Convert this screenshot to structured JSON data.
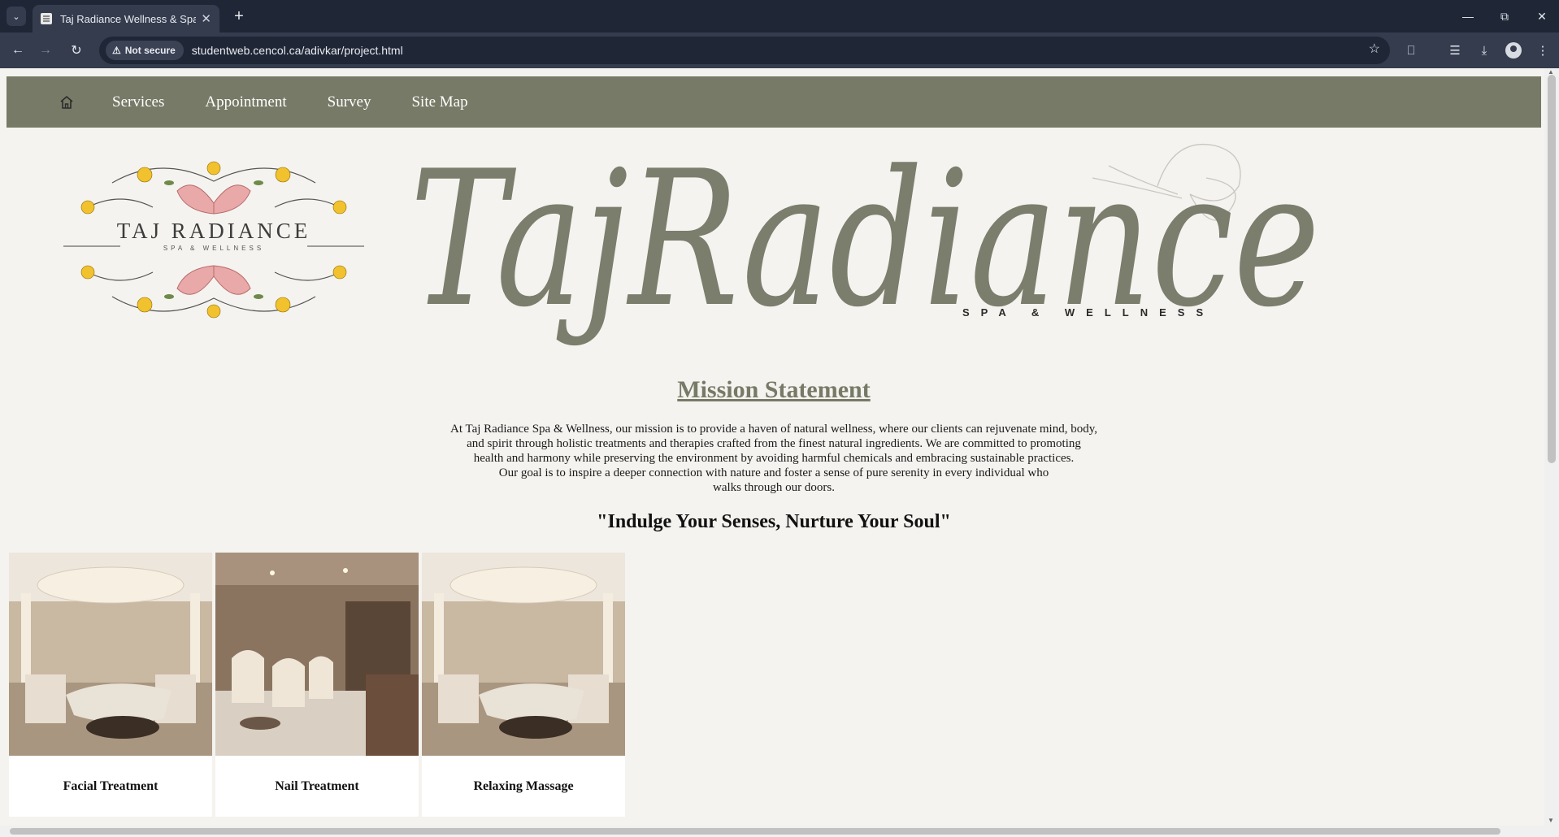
{
  "browser": {
    "tab_title": "Taj Radiance Wellness & Spa",
    "security_label": "Not secure",
    "url": "studentweb.cencol.ca/adivkar/project.html"
  },
  "nav": {
    "items": [
      "Services",
      "Appointment",
      "Survey",
      "Site Map"
    ]
  },
  "logo": {
    "emblem_name": "TAJ RADIANCE",
    "emblem_sub": "SPA & WELLNESS",
    "script_name": "TajRadiance",
    "script_sub": "SPA & WELLNESS"
  },
  "mission": {
    "title": "Mission Statement",
    "lines": [
      "At Taj Radiance Spa & Wellness, our mission is to provide a haven of natural wellness, where our clients can rejuvenate mind, body,",
      "and spirit through holistic treatments and therapies crafted from the finest natural ingredients. We are committed to promoting",
      "health and harmony while preserving the environment by avoiding harmful chemicals and embracing sustainable practices.",
      "Our goal is to inspire a deeper connection with nature and foster a sense of pure serenity in every individual who",
      "walks through our doors."
    ]
  },
  "tagline": "\"Indulge Your Senses, Nurture Your Soul\"",
  "services": [
    {
      "name": "Facial Treatment"
    },
    {
      "name": "Nail Treatment"
    },
    {
      "name": "Relaxing Massage"
    }
  ],
  "colors": {
    "accent": "#767a66",
    "background": "#f5f3ef",
    "petal": "#e9a9a9",
    "flower": "#f2c12e"
  }
}
